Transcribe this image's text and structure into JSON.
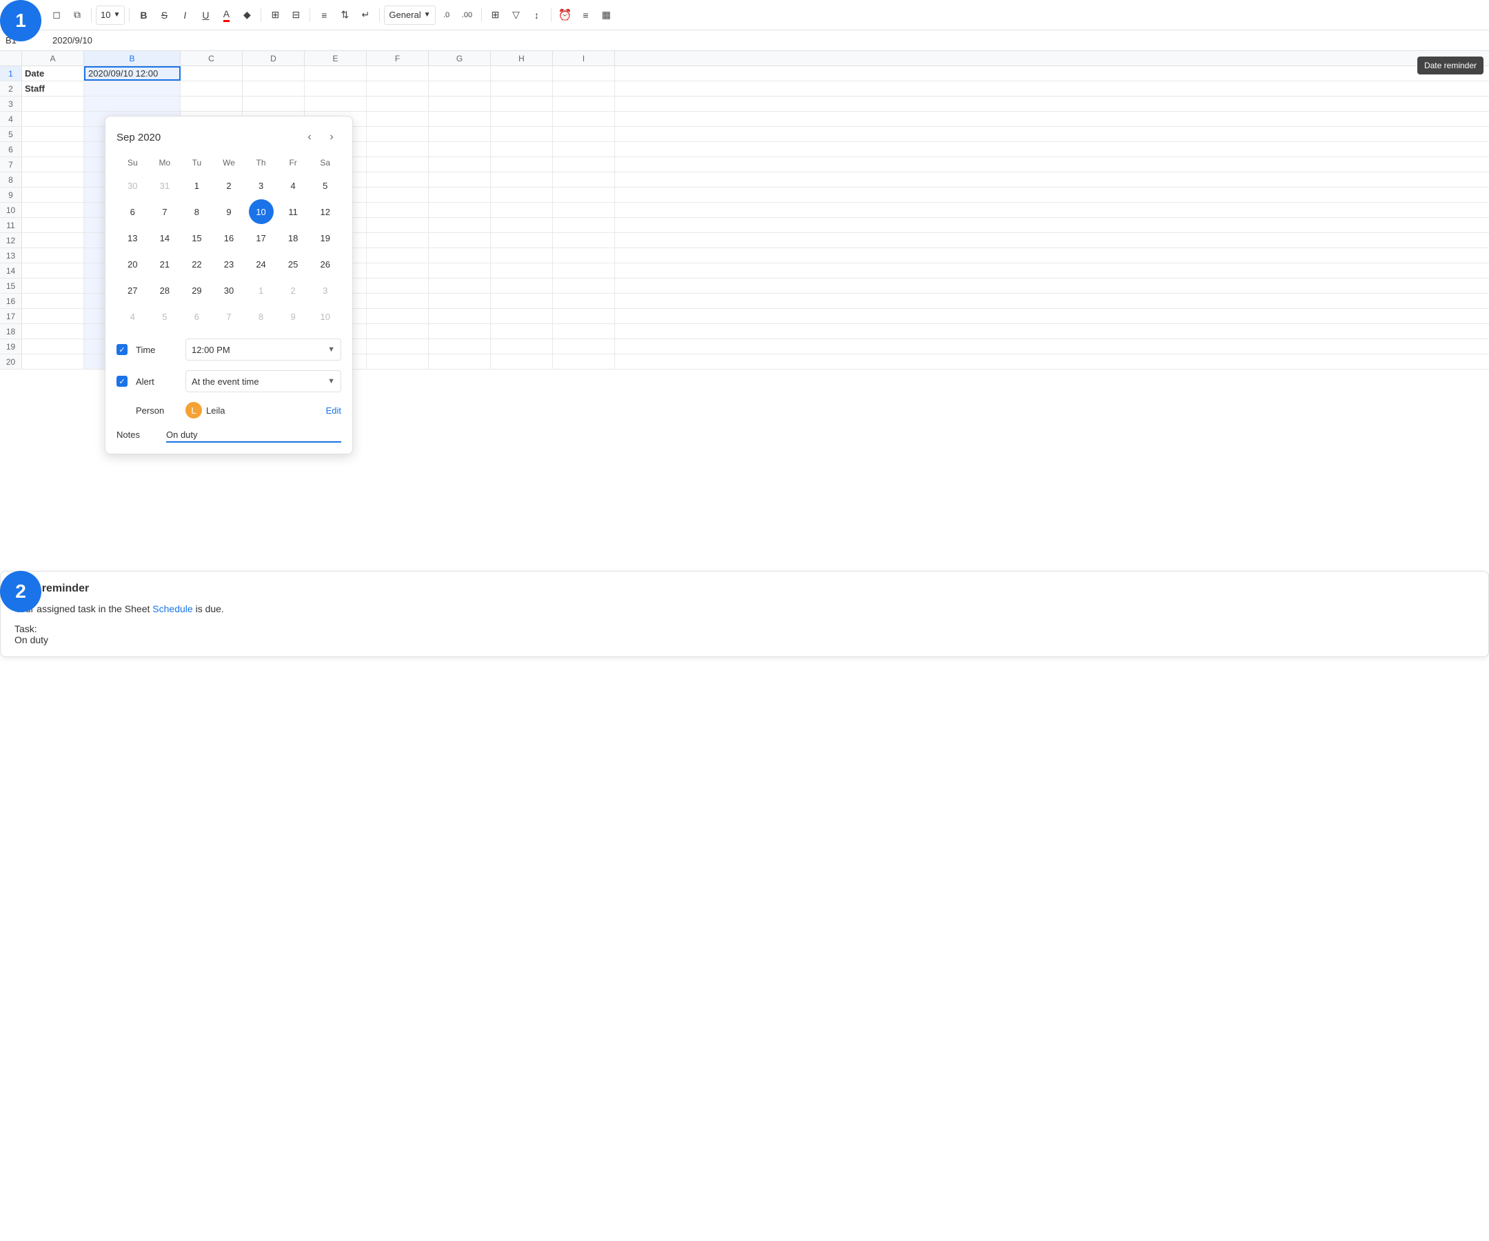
{
  "step1": {
    "label": "1"
  },
  "step2": {
    "label": "2"
  },
  "toolbar": {
    "font_size": "10",
    "format_label": "General",
    "undo_icon": "↩",
    "redo_icon": "↪",
    "eraser_icon": "◻",
    "copy_icon": "⧉",
    "bold_icon": "B",
    "strikethrough_icon": "S",
    "italic_icon": "I",
    "underline_icon": "U",
    "text_color_icon": "A",
    "fill_color_icon": "◆",
    "border_icon": "⊞",
    "merge_icon": "⊟",
    "align_h_icon": "≡",
    "align_v_icon": "⇅",
    "text_wrap_icon": "↵",
    "dec_decimal_icon": ".0",
    "inc_decimal_icon": ".00",
    "sheet_view_icon": "⊞",
    "filter_icon": "▽",
    "sort_icon": "↕",
    "reminder_icon": "⏰",
    "collapse_icon": "≡",
    "insert_icon": "▦"
  },
  "formula_bar": {
    "cell_ref": "B1",
    "content": "2020/9/10"
  },
  "tooltip": {
    "text": "Date reminder"
  },
  "columns": {
    "labels": [
      "",
      "A",
      "B",
      "C",
      "D",
      "E",
      "F",
      "G",
      "H",
      "I"
    ],
    "widths": [
      32,
      90,
      140,
      90,
      90,
      90,
      90,
      90,
      90,
      90
    ]
  },
  "rows": [
    {
      "num": 1,
      "cells": [
        "Date",
        "2020/09/10 12:00",
        "",
        "",
        "",
        "",
        "",
        "",
        ""
      ]
    },
    {
      "num": 2,
      "cells": [
        "Staff",
        "",
        "",
        "",
        "",
        "",
        "",
        "",
        ""
      ]
    },
    {
      "num": 3,
      "cells": [
        "",
        "",
        "",
        "",
        "",
        "",
        "",
        "",
        ""
      ]
    },
    {
      "num": 4,
      "cells": [
        "",
        "",
        "",
        "",
        "",
        "",
        "",
        "",
        ""
      ]
    },
    {
      "num": 5,
      "cells": [
        "",
        "",
        "",
        "",
        "",
        "",
        "",
        "",
        ""
      ]
    },
    {
      "num": 6,
      "cells": [
        "",
        "",
        "",
        "",
        "",
        "",
        "",
        "",
        ""
      ]
    },
    {
      "num": 7,
      "cells": [
        "",
        "",
        "",
        "",
        "",
        "",
        "",
        "",
        ""
      ]
    },
    {
      "num": 8,
      "cells": [
        "",
        "",
        "",
        "",
        "",
        "",
        "",
        "",
        ""
      ]
    },
    {
      "num": 9,
      "cells": [
        "",
        "",
        "",
        "",
        "",
        "",
        "",
        "",
        ""
      ]
    },
    {
      "num": 10,
      "cells": [
        "",
        "",
        "",
        "",
        "",
        "",
        "",
        "",
        ""
      ]
    },
    {
      "num": 11,
      "cells": [
        "",
        "",
        "",
        "",
        "",
        "",
        "",
        "",
        ""
      ]
    },
    {
      "num": 12,
      "cells": [
        "",
        "",
        "",
        "",
        "",
        "",
        "",
        "",
        ""
      ]
    },
    {
      "num": 13,
      "cells": [
        "",
        "",
        "",
        "",
        "",
        "",
        "",
        "",
        ""
      ]
    },
    {
      "num": 14,
      "cells": [
        "",
        "",
        "",
        "",
        "",
        "",
        "",
        "",
        ""
      ]
    },
    {
      "num": 15,
      "cells": [
        "",
        "",
        "",
        "",
        "",
        "",
        "",
        "",
        ""
      ]
    },
    {
      "num": 16,
      "cells": [
        "",
        "",
        "",
        "",
        "",
        "",
        "",
        "",
        ""
      ]
    },
    {
      "num": 17,
      "cells": [
        "",
        "",
        "",
        "",
        "",
        "",
        "",
        "",
        ""
      ]
    },
    {
      "num": 18,
      "cells": [
        "",
        "",
        "",
        "",
        "",
        "",
        "",
        "",
        ""
      ]
    },
    {
      "num": 19,
      "cells": [
        "",
        "",
        "",
        "",
        "",
        "",
        "",
        "",
        ""
      ]
    },
    {
      "num": 20,
      "cells": [
        "",
        "",
        "",
        "",
        "",
        "",
        "",
        "",
        ""
      ]
    }
  ],
  "calendar": {
    "month_year": "Sep 2020",
    "day_names": [
      "Su",
      "Mo",
      "Tu",
      "We",
      "Th",
      "Fr",
      "Sa"
    ],
    "days": [
      {
        "day": 30,
        "other": true
      },
      {
        "day": 31,
        "other": true
      },
      {
        "day": 1
      },
      {
        "day": 2
      },
      {
        "day": 3
      },
      {
        "day": 4
      },
      {
        "day": 5
      },
      {
        "day": 6
      },
      {
        "day": 7
      },
      {
        "day": 8
      },
      {
        "day": 9
      },
      {
        "day": 10,
        "selected": true
      },
      {
        "day": 11
      },
      {
        "day": 12
      },
      {
        "day": 13
      },
      {
        "day": 14
      },
      {
        "day": 15
      },
      {
        "day": 16
      },
      {
        "day": 17
      },
      {
        "day": 18
      },
      {
        "day": 19
      },
      {
        "day": 20
      },
      {
        "day": 21
      },
      {
        "day": 22
      },
      {
        "day": 23
      },
      {
        "day": 24
      },
      {
        "day": 25
      },
      {
        "day": 26
      },
      {
        "day": 27
      },
      {
        "day": 28
      },
      {
        "day": 29
      },
      {
        "day": 30
      },
      {
        "day": 1,
        "other": true
      },
      {
        "day": 2,
        "other": true
      },
      {
        "day": 3,
        "other": true
      },
      {
        "day": 4,
        "other": true
      },
      {
        "day": 5,
        "other": true
      },
      {
        "day": 6,
        "other": true
      },
      {
        "day": 7,
        "other": true
      },
      {
        "day": 8,
        "other": true
      },
      {
        "day": 9,
        "other": true
      },
      {
        "day": 10,
        "other": true
      }
    ],
    "time": {
      "label": "Time",
      "value": "12:00 PM"
    },
    "alert": {
      "label": "Alert",
      "value": "At the event time"
    },
    "person": {
      "label": "Person",
      "name": "Leila",
      "avatar_letter": "L",
      "edit_label": "Edit"
    },
    "notes": {
      "label": "Notes",
      "value": "On duty"
    }
  },
  "task_reminder": {
    "title": "Task reminder",
    "body": "Your assigned task in the Sheet",
    "sheet_link": "Schedule",
    "body_suffix": "is due.",
    "task_label": "Task:",
    "task_value": "On duty"
  }
}
